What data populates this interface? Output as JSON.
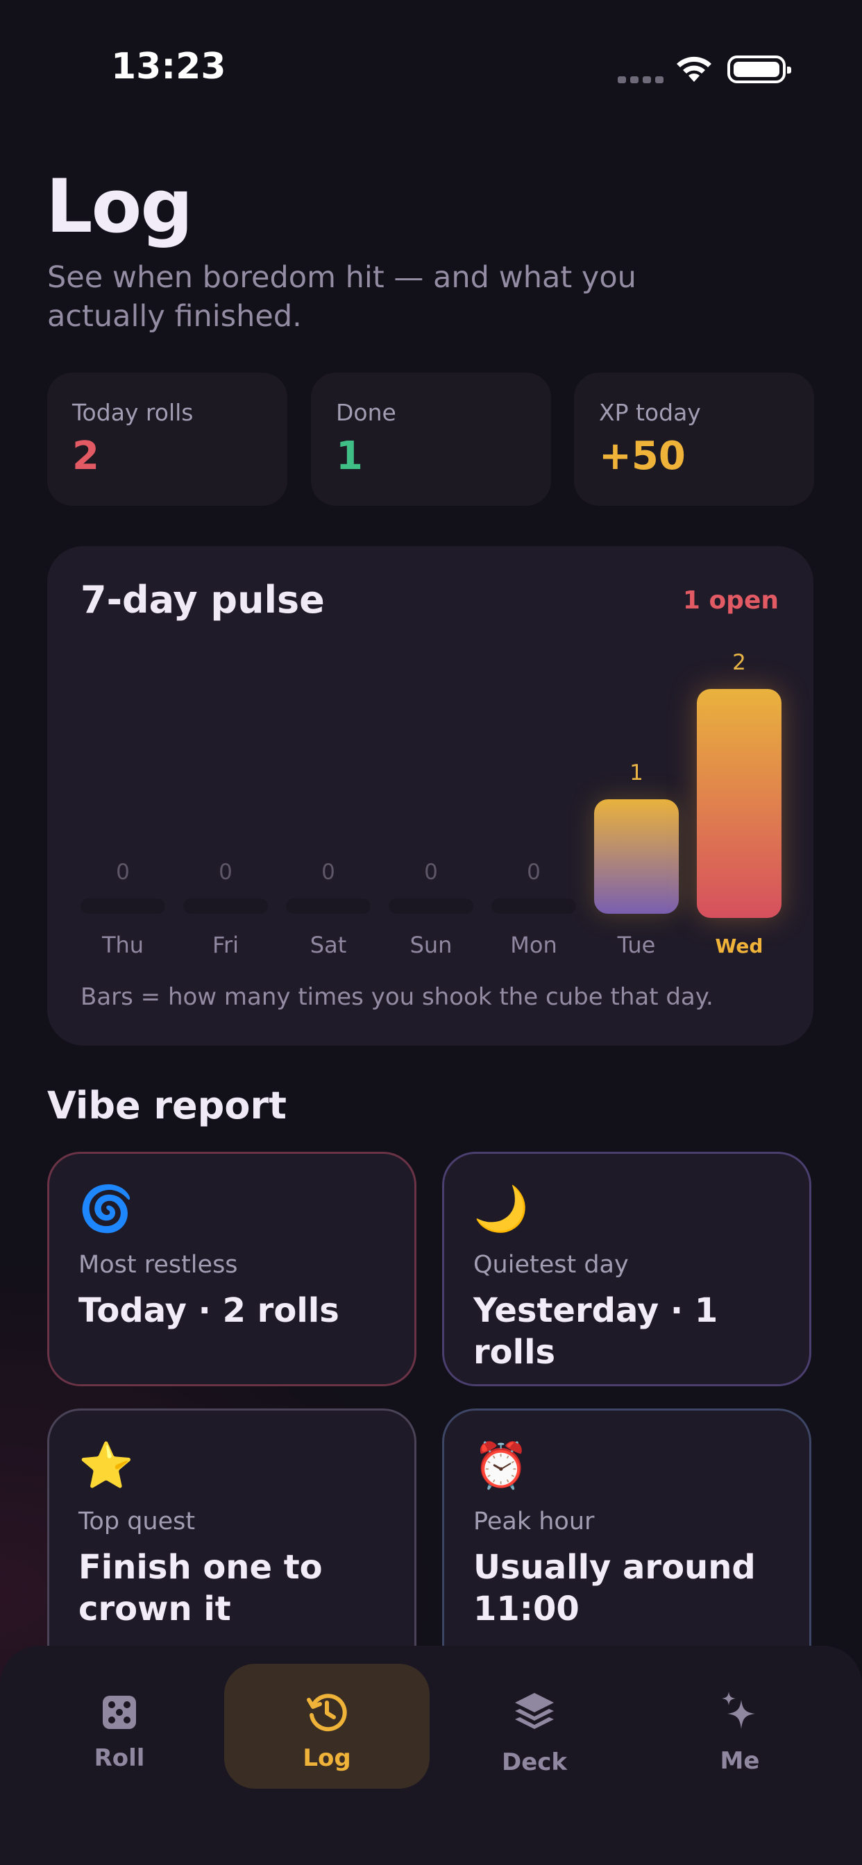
{
  "status_bar": {
    "time": "13:23"
  },
  "header": {
    "title": "Log",
    "subtitle": "See when boredom hit — and what you actually finished."
  },
  "stats": [
    {
      "label": "Today rolls",
      "value": "2",
      "color": "#e25a63"
    },
    {
      "label": "Done",
      "value": "1",
      "color": "#3fbf86"
    },
    {
      "label": "XP today",
      "value": "+50",
      "color": "#f0b33a"
    }
  ],
  "pulse": {
    "title": "7-day pulse",
    "open_badge": "1 open",
    "note": "Bars = how many times you shook the cube that day."
  },
  "chart_data": {
    "type": "bar",
    "categories": [
      "Thu",
      "Fri",
      "Sat",
      "Sun",
      "Mon",
      "Tue",
      "Wed"
    ],
    "values": [
      0,
      0,
      0,
      0,
      0,
      1,
      2
    ],
    "value_labels": [
      "0",
      "0",
      "0",
      "0",
      "0",
      "1",
      "2"
    ],
    "highlight": "Wed",
    "ylim": [
      0,
      2
    ],
    "grid": false,
    "title": "7-day pulse"
  },
  "vibe": {
    "title": "Vibe report",
    "cards": [
      {
        "emoji": "🌀",
        "icon": "cyclone-icon",
        "label": "Most restless",
        "value": "Today · 2 rolls",
        "border": "#6b3346"
      },
      {
        "emoji": "🌙",
        "icon": "crescent-moon-icon",
        "label": "Quietest day",
        "value": "Yesterday · 1 rolls",
        "border": "#4a3f6e"
      },
      {
        "emoji": "⭐",
        "icon": "star-icon",
        "label": "Top quest",
        "value": "Finish one to crown it",
        "border": "#4b4458"
      },
      {
        "emoji": "⏰",
        "icon": "alarm-clock-icon",
        "label": "Peak hour",
        "value": "Usually around 11:00",
        "border": "#3e4666"
      }
    ]
  },
  "nav": {
    "tabs": [
      {
        "label": "Roll",
        "icon": "dice-icon",
        "active": false
      },
      {
        "label": "Log",
        "icon": "history-icon",
        "active": true
      },
      {
        "label": "Deck",
        "icon": "layers-icon",
        "active": false
      },
      {
        "label": "Me",
        "icon": "sparkles-icon",
        "active": false
      }
    ]
  },
  "colors": {
    "accent": "#f0b33a",
    "bar_gradient_tue": [
      "#e9b23d",
      "#7a5fb0"
    ],
    "bar_gradient_wed": [
      "#e9b23d",
      "#d6505e"
    ],
    "inactive": "#8f88a0"
  }
}
